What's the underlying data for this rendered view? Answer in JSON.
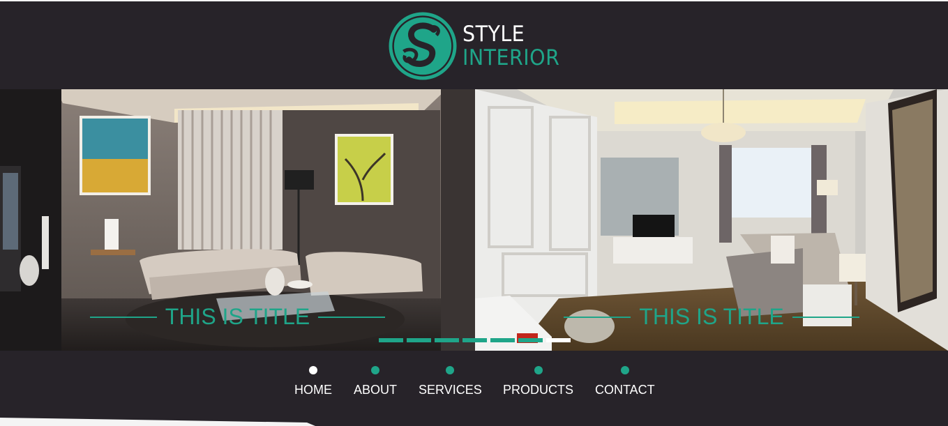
{
  "brand": {
    "line1": "STYLE",
    "line2": "INTERIOR",
    "logo_icon": "s-monogram-logo-icon",
    "accent": "#1fa589",
    "background": "#272329"
  },
  "slides": [
    {
      "title": "THIS IS TITLE",
      "image": "living-room-photo"
    },
    {
      "title": "THIS IS TITLE",
      "image": "bedroom-photo"
    }
  ],
  "pager": {
    "count": 7,
    "active_index": 6
  },
  "nav": {
    "items": [
      {
        "label": "HOME",
        "active": true
      },
      {
        "label": "ABOUT",
        "active": false
      },
      {
        "label": "SERVICES",
        "active": false
      },
      {
        "label": "PRODUCTS",
        "active": false
      },
      {
        "label": "CONTACT",
        "active": false
      }
    ]
  }
}
